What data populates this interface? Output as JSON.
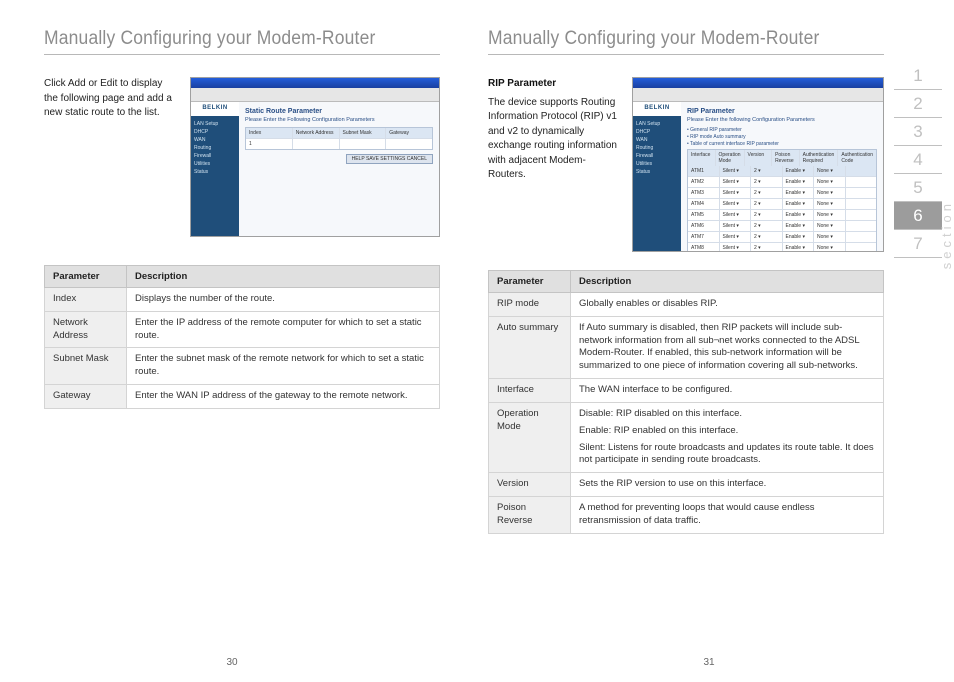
{
  "left": {
    "title": "Manually Configuring your Modem-Router",
    "intro": "Click Add or Edit to display the following page and add a new static route to the list.",
    "screenshot": {
      "brand": "BELKIN",
      "heading": "Static Route Parameter",
      "sub": "Please Enter the Following Configuration Parameters",
      "cols": [
        "Index",
        "Network Address",
        "Subnet Mask",
        "Gateway"
      ],
      "button": "HELP SAVE SETTINGS CANCEL"
    },
    "table": {
      "headers": [
        "Parameter",
        "Description"
      ],
      "rows": [
        {
          "p": "Index",
          "d": "Displays the number of the route."
        },
        {
          "p": "Network Address",
          "d": "Enter the IP address of the remote computer for which to set a static route."
        },
        {
          "p": "Subnet Mask",
          "d": "Enter the subnet mask of the remote network for which to set a static route."
        },
        {
          "p": "Gateway",
          "d": "Enter the WAN IP address of the gateway to the remote network."
        }
      ]
    },
    "page_num": "30"
  },
  "right": {
    "title": "Manually Configuring your Modem-Router",
    "subhead": "RIP Parameter",
    "intro": "The device supports Routing Information Protocol (RIP) v1 and v2 to dynamically exchange routing information with adjacent Modem-Routers.",
    "screenshot": {
      "brand": "BELKIN",
      "heading": "RIP Parameter",
      "sub": "Please Enter the following Configuration Parameters",
      "bullets": [
        "General RIP parameter",
        "RIP mode   Auto summary",
        "Table of current interface RIP parameter"
      ],
      "cols": [
        "Interface",
        "Operation Mode",
        "Version",
        "Poison Reverse",
        "Authentication Required",
        "Authentication Code"
      ]
    },
    "table": {
      "headers": [
        "Parameter",
        "Description"
      ],
      "rows": [
        {
          "p": "RIP mode",
          "d": [
            "Globally enables or disables RIP."
          ]
        },
        {
          "p": "Auto summary",
          "d": [
            "If Auto summary is disabled, then RIP packets will include sub-network information from all sub¬net works connected to the ADSL Modem-Router. If enabled, this sub-network information will be summarized to one piece of information covering all sub-networks."
          ]
        },
        {
          "p": "Interface",
          "d": [
            "The WAN interface to be configured."
          ]
        },
        {
          "p": "Operation Mode",
          "d": [
            "Disable: RIP disabled on this interface.",
            "Enable: RIP enabled on this interface.",
            "Silent: Listens for route broadcasts and updates its route table. It does not participate in sending route broadcasts."
          ]
        },
        {
          "p": "Version",
          "d": [
            "Sets the RIP version to use on this interface."
          ]
        },
        {
          "p": "Poison Reverse",
          "d": [
            "A method for preventing loops that would cause endless retransmission of data traffic."
          ]
        }
      ]
    },
    "page_num": "31",
    "tabs": [
      "1",
      "2",
      "3",
      "4",
      "5",
      "6",
      "7"
    ],
    "active_tab": 6,
    "section_label": "section"
  }
}
